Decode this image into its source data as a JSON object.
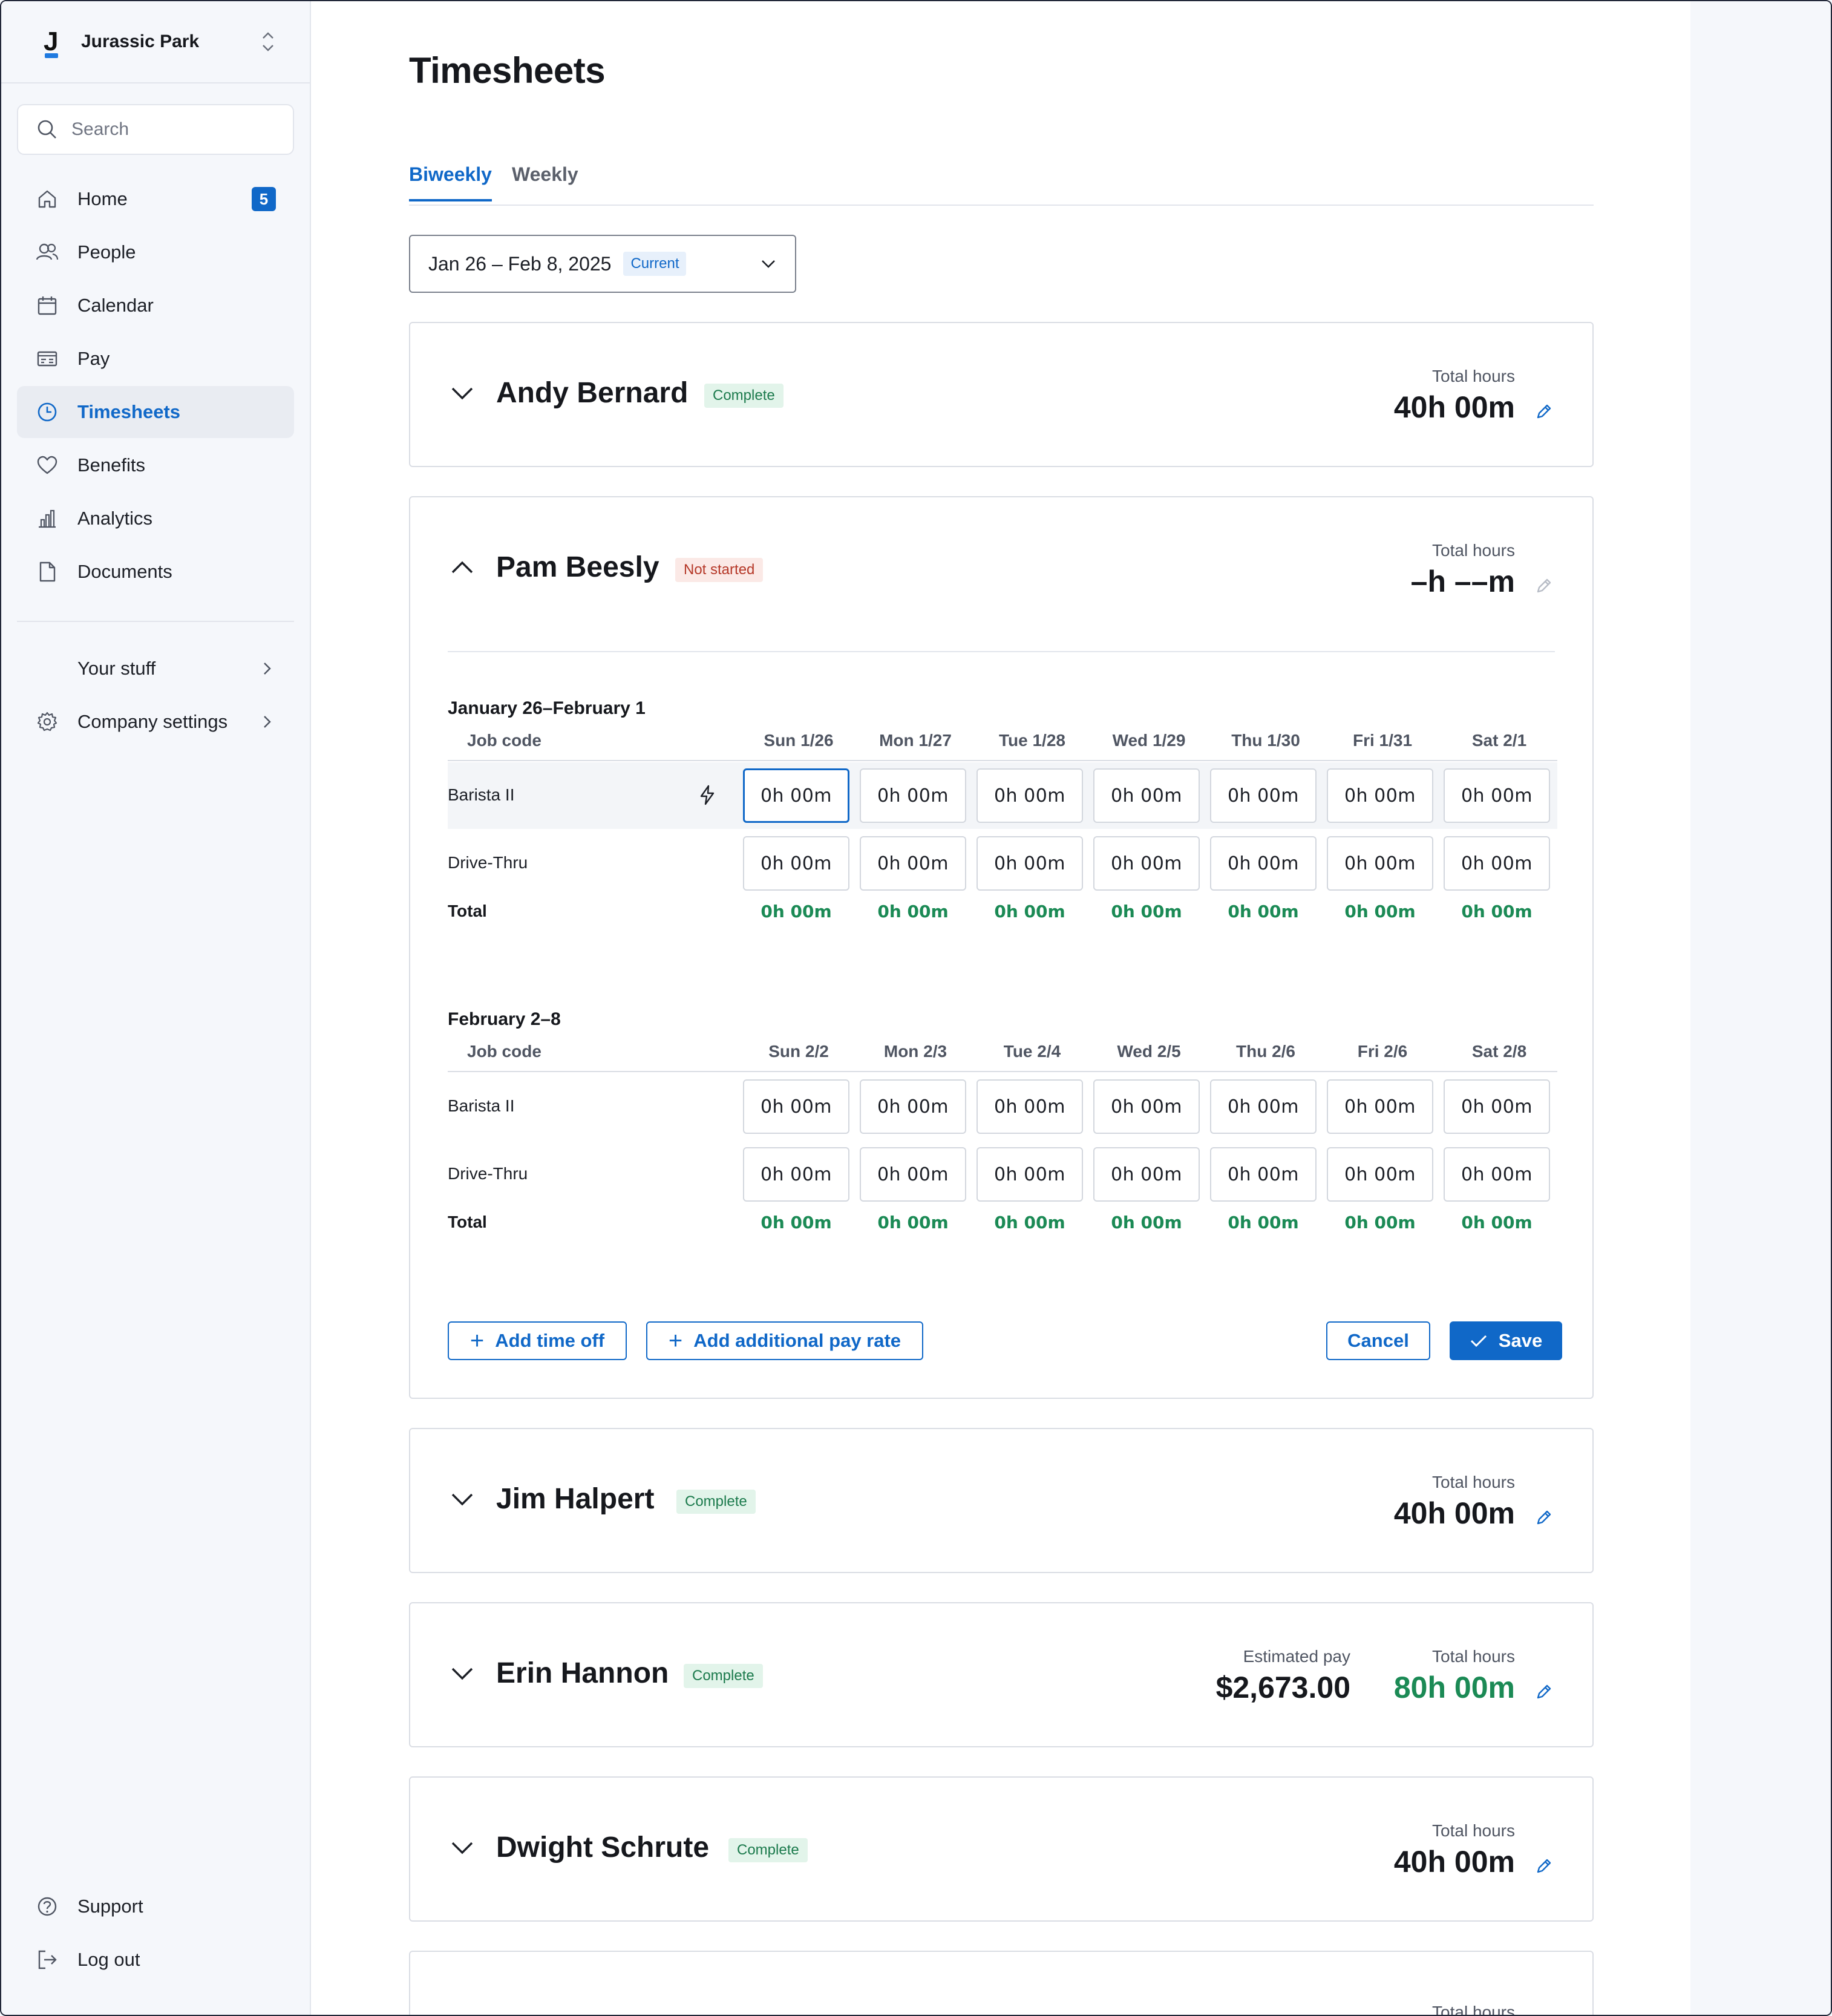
{
  "sidebar": {
    "org": {
      "logo": "J",
      "name": "Jurassic Park"
    },
    "search": {
      "placeholder": "Search"
    },
    "items": [
      {
        "label": "Home",
        "icon": "home-icon",
        "badge": "5"
      },
      {
        "label": "People",
        "icon": "people-icon"
      },
      {
        "label": "Calendar",
        "icon": "calendar-icon"
      },
      {
        "label": "Pay",
        "icon": "pay-icon"
      },
      {
        "label": "Timesheets",
        "icon": "clock-icon",
        "active": true
      },
      {
        "label": "Benefits",
        "icon": "heart-icon"
      },
      {
        "label": "Analytics",
        "icon": "bar-chart-icon"
      },
      {
        "label": "Documents",
        "icon": "document-icon"
      }
    ],
    "secondary": [
      {
        "label": "Your stuff"
      },
      {
        "label": "Company settings",
        "icon": "gear-icon"
      }
    ],
    "bottom": [
      {
        "label": "Support",
        "icon": "help-icon"
      },
      {
        "label": "Log out",
        "icon": "logout-icon"
      }
    ]
  },
  "main": {
    "title": "Timesheets",
    "tabs": [
      {
        "label": "Biweekly",
        "active": true
      },
      {
        "label": "Weekly"
      }
    ],
    "period": {
      "label": "Jan 26 – Feb 8, 2025",
      "tag": "Current"
    },
    "hours_label": "Total hours",
    "employees": [
      {
        "name": "Andy Bernard",
        "status": "Complete",
        "hours": "40h 00m"
      },
      {
        "name": "Pam Beesly",
        "status": "Not started",
        "hours": "–h ––m",
        "weeks": [
          {
            "title": "January 26–February 1",
            "days": [
              "Sun 1/26",
              "Mon 1/27",
              "Tue 1/28",
              "Wed 1/29",
              "Thu 1/30",
              "Fri 1/31",
              "Sat 2/1"
            ],
            "rows": [
              {
                "label": "Barista II",
                "cells": [
                  "0h 00m",
                  "0h 00m",
                  "0h 00m",
                  "0h 00m",
                  "0h 00m",
                  "0h 00m",
                  "0h 00m"
                ]
              },
              {
                "label": "Drive-Thru",
                "cells": [
                  "0h 00m",
                  "0h 00m",
                  "0h 00m",
                  "0h 00m",
                  "0h 00m",
                  "0h 00m",
                  "0h 00m"
                ]
              }
            ],
            "totals": [
              "0h 00m",
              "0h 00m",
              "0h 00m",
              "0h 00m",
              "0h 00m",
              "0h 00m",
              "0h 00m"
            ]
          },
          {
            "title": "February 2–8",
            "days": [
              "Sun 2/2",
              "Mon 2/3",
              "Tue 2/4",
              "Wed 2/5",
              "Thu 2/6",
              "Fri 2/6",
              "Sat 2/8"
            ],
            "rows": [
              {
                "label": "Barista II",
                "cells": [
                  "0h 00m",
                  "0h 00m",
                  "0h 00m",
                  "0h 00m",
                  "0h 00m",
                  "0h 00m",
                  "0h 00m"
                ]
              },
              {
                "label": "Drive-Thru",
                "cells": [
                  "0h 00m",
                  "0h 00m",
                  "0h 00m",
                  "0h 00m",
                  "0h 00m",
                  "0h 00m",
                  "0h 00m"
                ]
              }
            ],
            "totals": [
              "0h 00m",
              "0h 00m",
              "0h 00m",
              "0h 00m",
              "0h 00m",
              "0h 00m",
              "0h 00m"
            ]
          }
        ],
        "job_code_label": "Job code",
        "total_label": "Total",
        "actions": {
          "add_time_off": "Add time off",
          "add_pay_rate": "Add additional pay rate",
          "cancel": "Cancel",
          "save": "Save"
        }
      },
      {
        "name": "Jim Halpert",
        "status": "Complete",
        "hours": "40h 00m"
      },
      {
        "name": "Erin Hannon",
        "status": "Complete",
        "hours": "80h 00m",
        "pay_label": "Estimated pay",
        "pay": "$2,673.00"
      },
      {
        "name": "Dwight Schrute",
        "status": "Complete",
        "hours": "40h 00m"
      }
    ],
    "partial_card": {
      "hours_label": "Total hours"
    }
  },
  "colors": {
    "accent": "#1068c8",
    "success": "#1b8a55",
    "danger": "#b53828"
  }
}
